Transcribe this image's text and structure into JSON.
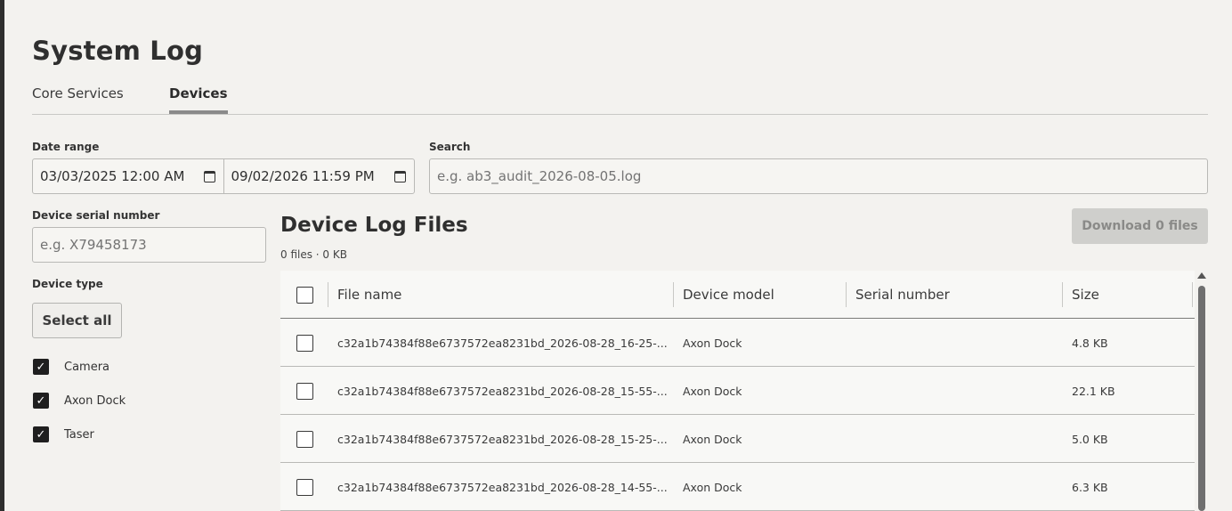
{
  "page": {
    "title": "System Log"
  },
  "tabs": [
    {
      "label": "Core Services",
      "active": false
    },
    {
      "label": "Devices",
      "active": true
    }
  ],
  "filters": {
    "date_range_label": "Date range",
    "date_start": "03/03/2025 12:00 AM",
    "date_end": "09/02/2026 11:59 PM",
    "search_label": "Search",
    "search_placeholder": "e.g. ab3_audit_2026-08-05.log",
    "serial_label": "Device serial number",
    "serial_placeholder": "e.g. X79458173",
    "device_type_label": "Device type",
    "select_all_label": "Select all",
    "device_types": [
      {
        "label": "Camera",
        "checked": true
      },
      {
        "label": "Axon Dock",
        "checked": true
      },
      {
        "label": "Taser",
        "checked": true
      }
    ]
  },
  "files": {
    "title": "Device Log Files",
    "summary": "0 files · 0 KB",
    "download_label": "Download 0 files",
    "columns": [
      "File name",
      "Device model",
      "Serial number",
      "Size"
    ],
    "rows": [
      {
        "file_name": "c32a1b74384f88e6737572ea8231bd_2026-08-28_16-25-...",
        "device_model": "Axon Dock",
        "serial": "",
        "size": "4.8 KB"
      },
      {
        "file_name": "c32a1b74384f88e6737572ea8231bd_2026-08-28_15-55-...",
        "device_model": "Axon Dock",
        "serial": "",
        "size": "22.1 KB"
      },
      {
        "file_name": "c32a1b74384f88e6737572ea8231bd_2026-08-28_15-25-...",
        "device_model": "Axon Dock",
        "serial": "",
        "size": "5.0 KB"
      },
      {
        "file_name": "c32a1b74384f88e6737572ea8231bd_2026-08-28_14-55-...",
        "device_model": "Axon Dock",
        "serial": "",
        "size": "6.3 KB"
      }
    ]
  },
  "icons": {
    "calendar": "calendar-icon",
    "checkmark": "check-icon",
    "scroll_up": "chevron-up-icon"
  }
}
